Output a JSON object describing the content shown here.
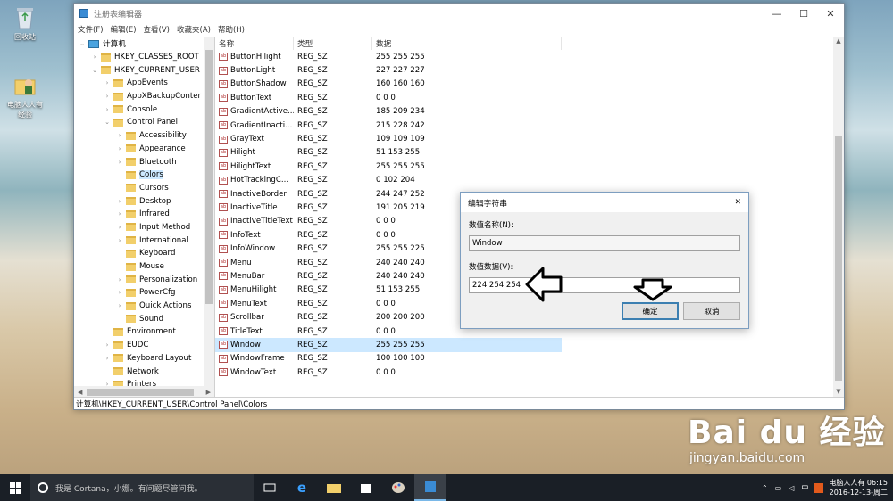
{
  "desktop": {
    "icons": [
      {
        "label": "回收站"
      },
      {
        "label": "电脑人人有 经验"
      }
    ]
  },
  "window": {
    "title": "注册表编辑器",
    "controls": {
      "minimize": "—",
      "maximize": "☐",
      "close": "✕"
    },
    "menu": [
      "文件(F)",
      "编辑(E)",
      "查看(V)",
      "收藏夹(A)",
      "帮助(H)"
    ],
    "tree": {
      "items": [
        {
          "label": "计算机",
          "exp": "⌄",
          "indent": 0,
          "icon": "computer"
        },
        {
          "label": "HKEY_CLASSES_ROOT",
          "exp": "›",
          "indent": 1
        },
        {
          "label": "HKEY_CURRENT_USER",
          "exp": "⌄",
          "indent": 1
        },
        {
          "label": "AppEvents",
          "exp": "›",
          "indent": 2
        },
        {
          "label": "AppXBackupConter",
          "exp": "›",
          "indent": 2
        },
        {
          "label": "Console",
          "exp": "›",
          "indent": 2
        },
        {
          "label": "Control Panel",
          "exp": "⌄",
          "indent": 2
        },
        {
          "label": "Accessibility",
          "exp": "›",
          "indent": 3
        },
        {
          "label": "Appearance",
          "exp": "›",
          "indent": 3
        },
        {
          "label": "Bluetooth",
          "exp": "›",
          "indent": 3
        },
        {
          "label": "Colors",
          "exp": "",
          "indent": 3,
          "selected": true
        },
        {
          "label": "Cursors",
          "exp": "",
          "indent": 3
        },
        {
          "label": "Desktop",
          "exp": "›",
          "indent": 3
        },
        {
          "label": "Infrared",
          "exp": "›",
          "indent": 3
        },
        {
          "label": "Input Method",
          "exp": "›",
          "indent": 3
        },
        {
          "label": "International",
          "exp": "›",
          "indent": 3
        },
        {
          "label": "Keyboard",
          "exp": "",
          "indent": 3
        },
        {
          "label": "Mouse",
          "exp": "",
          "indent": 3
        },
        {
          "label": "Personalization",
          "exp": "›",
          "indent": 3
        },
        {
          "label": "PowerCfg",
          "exp": "›",
          "indent": 3
        },
        {
          "label": "Quick Actions",
          "exp": "›",
          "indent": 3
        },
        {
          "label": "Sound",
          "exp": "",
          "indent": 3
        },
        {
          "label": "Environment",
          "exp": "",
          "indent": 2
        },
        {
          "label": "EUDC",
          "exp": "›",
          "indent": 2
        },
        {
          "label": "Keyboard Layout",
          "exp": "›",
          "indent": 2
        },
        {
          "label": "Network",
          "exp": "",
          "indent": 2
        },
        {
          "label": "Printers",
          "exp": "›",
          "indent": 2
        }
      ]
    },
    "list": {
      "columns": [
        "名称",
        "类型",
        "数据"
      ],
      "rows": [
        {
          "name": "ButtonHilight",
          "type": "REG_SZ",
          "data": "255 255 255"
        },
        {
          "name": "ButtonLight",
          "type": "REG_SZ",
          "data": "227 227 227"
        },
        {
          "name": "ButtonShadow",
          "type": "REG_SZ",
          "data": "160 160 160"
        },
        {
          "name": "ButtonText",
          "type": "REG_SZ",
          "data": "0 0 0"
        },
        {
          "name": "GradientActive...",
          "type": "REG_SZ",
          "data": "185 209 234"
        },
        {
          "name": "GradientInacti...",
          "type": "REG_SZ",
          "data": "215 228 242"
        },
        {
          "name": "GrayText",
          "type": "REG_SZ",
          "data": "109 109 109"
        },
        {
          "name": "Hilight",
          "type": "REG_SZ",
          "data": "51 153 255"
        },
        {
          "name": "HilightText",
          "type": "REG_SZ",
          "data": "255 255 255"
        },
        {
          "name": "HotTrackingC...",
          "type": "REG_SZ",
          "data": "0 102 204"
        },
        {
          "name": "InactiveBorder",
          "type": "REG_SZ",
          "data": "244 247 252"
        },
        {
          "name": "InactiveTitle",
          "type": "REG_SZ",
          "data": "191 205 219"
        },
        {
          "name": "InactiveTitleText",
          "type": "REG_SZ",
          "data": "0 0 0"
        },
        {
          "name": "InfoText",
          "type": "REG_SZ",
          "data": "0 0 0"
        },
        {
          "name": "InfoWindow",
          "type": "REG_SZ",
          "data": "255 255 225"
        },
        {
          "name": "Menu",
          "type": "REG_SZ",
          "data": "240 240 240"
        },
        {
          "name": "MenuBar",
          "type": "REG_SZ",
          "data": "240 240 240"
        },
        {
          "name": "MenuHilight",
          "type": "REG_SZ",
          "data": "51 153 255"
        },
        {
          "name": "MenuText",
          "type": "REG_SZ",
          "data": "0 0 0"
        },
        {
          "name": "Scrollbar",
          "type": "REG_SZ",
          "data": "200 200 200"
        },
        {
          "name": "TitleText",
          "type": "REG_SZ",
          "data": "0 0 0"
        },
        {
          "name": "Window",
          "type": "REG_SZ",
          "data": "255 255 255",
          "selected": true
        },
        {
          "name": "WindowFrame",
          "type": "REG_SZ",
          "data": "100 100 100"
        },
        {
          "name": "WindowText",
          "type": "REG_SZ",
          "data": "0 0 0"
        }
      ]
    },
    "status_path": "计算机\\HKEY_CURRENT_USER\\Control Panel\\Colors"
  },
  "dialog": {
    "title": "编辑字符串",
    "name_label": "数值名称(N):",
    "name_value": "Window",
    "data_label": "数值数据(V):",
    "data_value": "224 254 254",
    "ok_label": "确定",
    "cancel_label": "取消",
    "close": "✕"
  },
  "taskbar": {
    "search_placeholder": "我是 Cortana，小娜。有问题尽管问我。",
    "tray_ime": "中",
    "clock_line1": "电脑人人有 06:15",
    "clock_line2": "2016-12-13-周二"
  },
  "watermark": {
    "brand": "Bai du 经验",
    "url": "jingyan.baidu.com"
  },
  "colors": {
    "selection": "#cce8ff",
    "accent": "#3c7fb1",
    "taskbar": "#1a1f26"
  }
}
